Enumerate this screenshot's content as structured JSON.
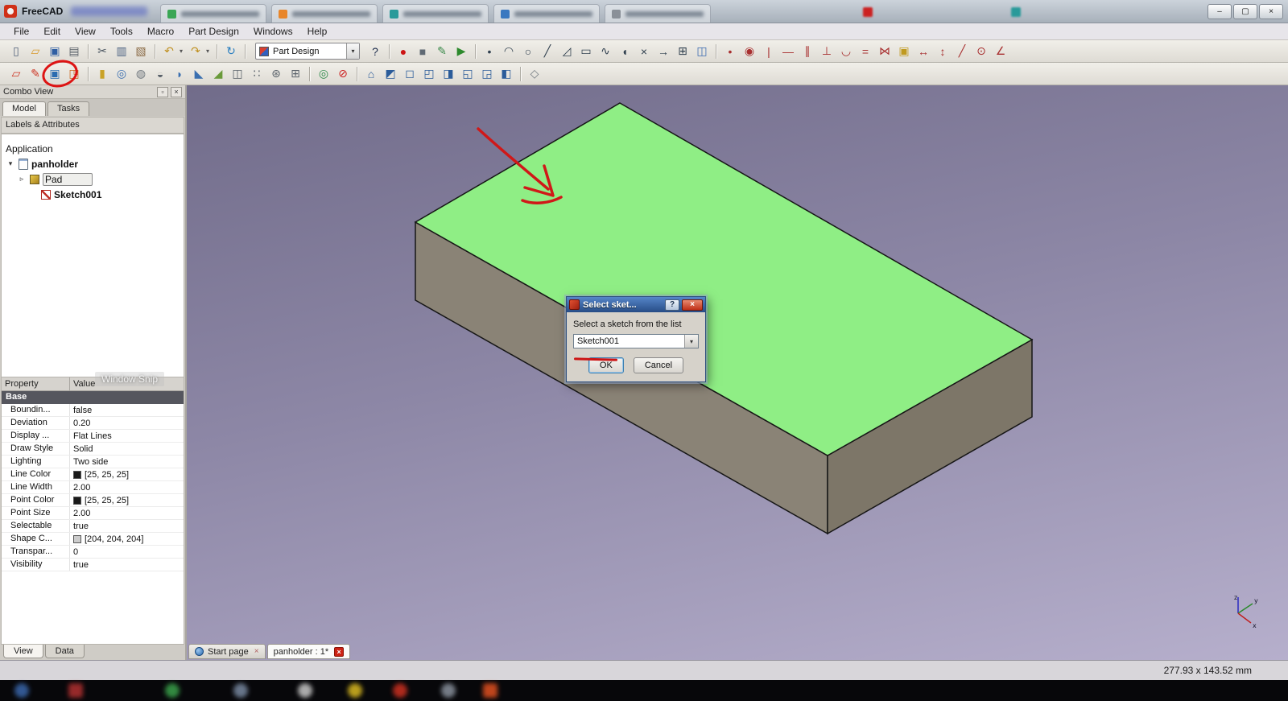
{
  "window": {
    "title": "FreeCAD",
    "controls": {
      "minimize": "–",
      "maximize": "▢",
      "close": "×"
    }
  },
  "glyphs": {
    "dropdown": "▾",
    "expand": "▾",
    "collapse": "▹",
    "close": "×",
    "float": "▫",
    "help": "?"
  },
  "menu": {
    "items": [
      "File",
      "Edit",
      "View",
      "Tools",
      "Macro",
      "Part Design",
      "Windows",
      "Help"
    ]
  },
  "toolbar_file": {
    "workbench_selector": {
      "value": "Part Design"
    },
    "icons_left": [
      {
        "n": "new-file-icon",
        "g": "▯",
        "c": "#50607a"
      },
      {
        "n": "open-folder-icon",
        "g": "▱",
        "c": "#d8992a"
      },
      {
        "n": "save-icon",
        "g": "▣",
        "c": "#2f5fa3"
      },
      {
        "n": "print-icon",
        "g": "▤",
        "c": "#596068"
      },
      {
        "sep": true
      },
      {
        "n": "cut-icon",
        "g": "✂",
        "c": "#4a5560"
      },
      {
        "n": "copy-icon",
        "g": "▥",
        "c": "#4a6080"
      },
      {
        "n": "paste-icon",
        "g": "▧",
        "c": "#8a6a45"
      },
      {
        "sep": true
      },
      {
        "n": "undo-icon",
        "g": "↶",
        "c": "#c09020"
      },
      {
        "n": "undo-history-arrow-icon",
        "g": "▾",
        "c": "#555",
        "cls": "narrow"
      },
      {
        "n": "redo-icon",
        "g": "↷",
        "c": "#c09020"
      },
      {
        "n": "redo-history-arrow-icon",
        "g": "▾",
        "c": "#555",
        "cls": "narrow"
      },
      {
        "sep": true
      },
      {
        "n": "refresh-icon",
        "g": "↻",
        "c": "#2a7fc0"
      },
      {
        "sep": true
      }
    ],
    "icons_right": [
      {
        "n": "whats-this-icon",
        "g": "?",
        "c": "#1a2a4a"
      },
      {
        "sep": true
      },
      {
        "n": "macro-record-icon",
        "g": "●",
        "c": "#cc1515"
      },
      {
        "n": "macro-stop-icon",
        "g": "■",
        "c": "#606a74"
      },
      {
        "n": "macro-edit-icon",
        "g": "✎",
        "c": "#3a8a4a"
      },
      {
        "n": "macro-execute-icon",
        "g": "▶",
        "c": "#2d8a2d"
      },
      {
        "sep": true
      },
      {
        "n": "sketch-point-icon",
        "g": "•",
        "c": "#30404f"
      },
      {
        "n": "sketch-arc-icon",
        "g": "◠",
        "c": "#30404f"
      },
      {
        "n": "sketch-circle-icon",
        "g": "○",
        "c": "#30404f"
      },
      {
        "n": "sketch-line-icon",
        "g": "╱",
        "c": "#30404f"
      },
      {
        "n": "sketch-polyline-icon",
        "g": "◿",
        "c": "#30404f"
      },
      {
        "n": "sketch-rectangle-icon",
        "g": "▭",
        "c": "#30404f"
      },
      {
        "n": "sketch-bspline-icon",
        "g": "∿",
        "c": "#30404f"
      },
      {
        "n": "sketch-slot-icon",
        "g": "◖",
        "c": "#30404f"
      },
      {
        "n": "sketch-trim-icon",
        "g": "×",
        "c": "#30404f"
      },
      {
        "n": "sketch-extend-icon",
        "g": "→",
        "c": "#30404f"
      },
      {
        "n": "sketch-external-geometry-icon",
        "g": "⊞",
        "c": "#30404f"
      },
      {
        "n": "sketch-construction-mode-icon",
        "g": "◫",
        "c": "#3a6ab0"
      },
      {
        "sep": true
      },
      {
        "n": "constraint-coincident-icon",
        "g": "•",
        "c": "#a83030"
      },
      {
        "n": "constraint-point-on-object-icon",
        "g": "◉",
        "c": "#a83030"
      },
      {
        "n": "constraint-vertical-icon",
        "g": "|",
        "c": "#a83030"
      },
      {
        "n": "constraint-horizontal-icon",
        "g": "—",
        "c": "#a83030"
      },
      {
        "n": "constraint-parallel-icon",
        "g": "∥",
        "c": "#a83030"
      },
      {
        "n": "constraint-perpendicular-icon",
        "g": "⊥",
        "c": "#a83030"
      },
      {
        "n": "constraint-tangent-icon",
        "g": "◡",
        "c": "#a83030"
      },
      {
        "n": "constraint-equal-icon",
        "g": "=",
        "c": "#a83030"
      },
      {
        "n": "constraint-symmetric-icon",
        "g": "⋈",
        "c": "#a83030"
      },
      {
        "n": "constraint-lock-icon",
        "g": "▣",
        "c": "#c09a20"
      },
      {
        "n": "constraint-horizontal-distance-icon",
        "g": "↔",
        "c": "#a83030"
      },
      {
        "n": "constraint-vertical-distance-icon",
        "g": "↕",
        "c": "#a83030"
      },
      {
        "n": "constraint-distance-icon",
        "g": "╱",
        "c": "#a83030"
      },
      {
        "n": "constraint-radius-icon",
        "g": "⊙",
        "c": "#a83030"
      },
      {
        "n": "constraint-angle-icon",
        "g": "∠",
        "c": "#a83030"
      }
    ]
  },
  "toolbar_partdesign": {
    "icons": [
      {
        "n": "create-sketch-icon",
        "g": "▱",
        "c": "#cc3322"
      },
      {
        "n": "edit-sketch-icon",
        "g": "✎",
        "c": "#cc3322"
      },
      {
        "n": "map-sketch-to-face-icon",
        "g": "▣",
        "c": "#2b6cb0"
      },
      {
        "n": "reorient-sketch-icon",
        "g": "◳",
        "c": "#cc6a22"
      },
      {
        "sep": true
      },
      {
        "n": "pad-icon",
        "g": "▮",
        "c": "#c9a227"
      },
      {
        "n": "revolve-icon",
        "g": "◎",
        "c": "#3a6fb0"
      },
      {
        "n": "groove-icon",
        "g": "◍",
        "c": "#70787f"
      },
      {
        "n": "pocket-icon",
        "g": "◒",
        "c": "#5a626a"
      },
      {
        "n": "fillet-icon",
        "g": "◗",
        "c": "#3a6fb0"
      },
      {
        "n": "chamfer-icon",
        "g": "◣",
        "c": "#3a6fb0"
      },
      {
        "n": "draft-icon",
        "g": "◢",
        "c": "#6a9a3a"
      },
      {
        "n": "mirrored-icon",
        "g": "◫",
        "c": "#5a626a"
      },
      {
        "n": "linear-pattern-icon",
        "g": "∷",
        "c": "#5a626a"
      },
      {
        "n": "polar-pattern-icon",
        "g": "⊛",
        "c": "#5a626a"
      },
      {
        "n": "multitransform-icon",
        "g": "⊞",
        "c": "#5a626a"
      },
      {
        "sep": true
      },
      {
        "n": "zoom-fit-all-icon",
        "g": "◎",
        "c": "#2d8a4a"
      },
      {
        "n": "draw-style-icon",
        "g": "⊘",
        "c": "#cc2020"
      },
      {
        "sep": true
      },
      {
        "n": "view-home-icon",
        "g": "⌂",
        "c": "#2b5c9a"
      },
      {
        "n": "view-isometric-icon",
        "g": "◩",
        "c": "#2b5c9a"
      },
      {
        "n": "view-front-icon",
        "g": "◻",
        "c": "#2b5c9a"
      },
      {
        "n": "view-top-icon",
        "g": "◰",
        "c": "#2b5c9a"
      },
      {
        "n": "view-right-icon",
        "g": "◨",
        "c": "#2b5c9a"
      },
      {
        "n": "view-rear-icon",
        "g": "◱",
        "c": "#2b5c9a"
      },
      {
        "n": "view-bottom-icon",
        "g": "◲",
        "c": "#2b5c9a"
      },
      {
        "n": "view-left-icon",
        "g": "◧",
        "c": "#2b5c9a"
      },
      {
        "sep": true
      },
      {
        "n": "measure-icon",
        "g": "◇",
        "c": "#70787f"
      }
    ]
  },
  "combo_view": {
    "title": "Combo View",
    "tabs": [
      {
        "label": "Model"
      },
      {
        "label": "Tasks"
      }
    ],
    "labels_header": "Labels & Attributes",
    "tree": {
      "root": "Application",
      "document": "panholder",
      "items": [
        {
          "label": "Pad"
        },
        {
          "label": "Sketch001"
        }
      ]
    },
    "property_editor": {
      "columns": [
        "Property",
        "Value"
      ],
      "group_label": "Base",
      "rows": [
        {
          "property": "Boundin...",
          "value": "false"
        },
        {
          "property": "Deviation",
          "value": "0.20"
        },
        {
          "property": "Display ...",
          "value": "Flat Lines"
        },
        {
          "property": "Draw Style",
          "value": "Solid"
        },
        {
          "property": "Lighting",
          "value": "Two side"
        },
        {
          "property": "Line Color",
          "value": "[25, 25, 25]",
          "swatch": "#191919"
        },
        {
          "property": "Line Width",
          "value": "2.00"
        },
        {
          "property": "Point Color",
          "value": "[25, 25, 25]",
          "swatch": "#191919"
        },
        {
          "property": "Point Size",
          "value": "2.00"
        },
        {
          "property": "Selectable",
          "value": "true"
        },
        {
          "property": "Shape C...",
          "value": "[204, 204, 204]",
          "swatch": "#cccccc"
        },
        {
          "property": "Transpar...",
          "value": "0"
        },
        {
          "property": "Visibility",
          "value": "true"
        }
      ]
    },
    "bottom_tabs": [
      {
        "label": "View"
      },
      {
        "label": "Data"
      }
    ]
  },
  "overlay": {
    "snip_text": "Window Snip"
  },
  "viewport": {
    "background": "linear-gradient(168deg, #716c8a 0%, #8d87a6 45%, #b6afcc 100%)",
    "box": {
      "top_face": "#8fee85",
      "left_face": "#8a8376",
      "right_face": "#7d7668",
      "edge": "#161616"
    },
    "annotation_color": "#d01818",
    "axis_labels": {
      "x": "x",
      "y": "y",
      "z": "z"
    }
  },
  "dialog": {
    "title": "Select sket...",
    "message": "Select a sketch from the list",
    "sketch_combo": {
      "value": "Sketch001"
    },
    "ok_label": "OK",
    "cancel_label": "Cancel"
  },
  "doc_tabs": [
    {
      "label": "Start page"
    },
    {
      "label": "panholder : 1*"
    }
  ],
  "status": {
    "dimensions": "277.93 x 143.52 mm"
  }
}
